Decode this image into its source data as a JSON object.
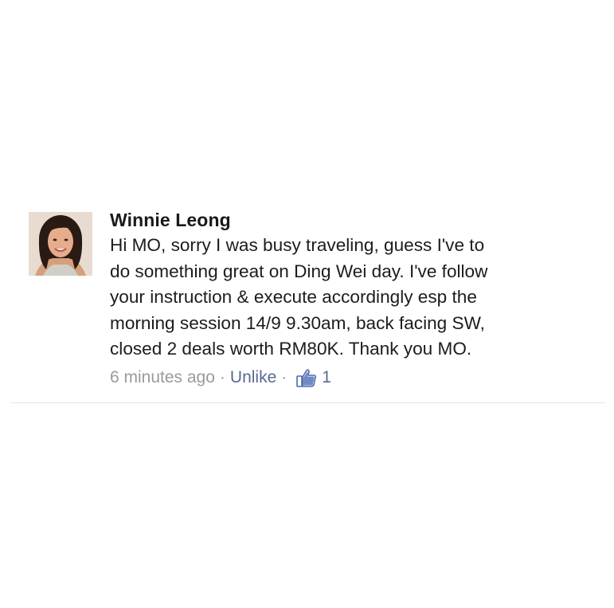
{
  "comment": {
    "author": "Winnie Leong",
    "text_lines": [
      "Hi MO, sorry I was busy traveling, guess I've to",
      "do something great on Ding Wei day. I've follow",
      "your instruction & execute accordingly esp the",
      "morning session 14/9 9.30am, back facing SW,",
      "closed 2 deals worth RM80K. Thank you MO."
    ],
    "timestamp": "6 minutes ago",
    "separator": "·",
    "unlike_label": "Unlike",
    "like_count": "1",
    "like_icon": "thumbs-up-icon"
  },
  "colors": {
    "link": "#596a92",
    "meta_gray": "#9a9a9a",
    "like_blue": "#4a69ad"
  }
}
